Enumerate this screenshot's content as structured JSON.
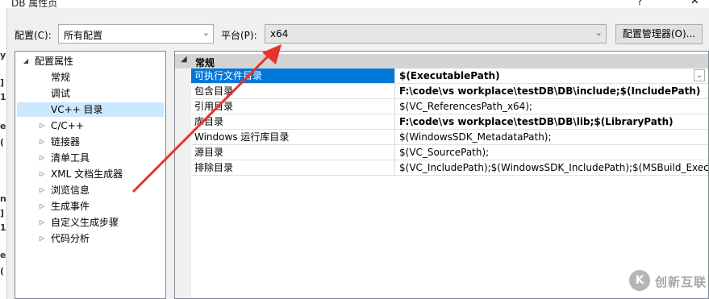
{
  "window": {
    "title": "DB 属性页",
    "help_label": "?",
    "close_label": "✕"
  },
  "left_strip_chars": [
    "y",
    "]",
    "1",
    "e",
    "(",
    "n",
    "]",
    "1",
    "e",
    "("
  ],
  "config": {
    "label": "配置(C):",
    "value": "所有配置"
  },
  "platform": {
    "label": "平台(P):",
    "value": "x64"
  },
  "config_manager_button": "配置管理器(O)...",
  "tree": {
    "root": "配置属性",
    "items": [
      {
        "label": "常规",
        "expandable": false,
        "selected": false
      },
      {
        "label": "调试",
        "expandable": false,
        "selected": false
      },
      {
        "label": "VC++ 目录",
        "expandable": false,
        "selected": true
      },
      {
        "label": "C/C++",
        "expandable": true,
        "selected": false
      },
      {
        "label": "链接器",
        "expandable": true,
        "selected": false
      },
      {
        "label": "清单工具",
        "expandable": true,
        "selected": false
      },
      {
        "label": "XML 文档生成器",
        "expandable": true,
        "selected": false
      },
      {
        "label": "浏览信息",
        "expandable": true,
        "selected": false
      },
      {
        "label": "生成事件",
        "expandable": true,
        "selected": false
      },
      {
        "label": "自定义生成步骤",
        "expandable": true,
        "selected": false
      },
      {
        "label": "代码分析",
        "expandable": true,
        "selected": false
      }
    ]
  },
  "grid": {
    "category": "常规",
    "rows": [
      {
        "name": "可执行文件目录",
        "value": "$(ExecutablePath)",
        "bold": true,
        "selected": true
      },
      {
        "name": "包含目录",
        "value": "F:\\code\\vs workplace\\testDB\\DB\\include;$(IncludePath)",
        "bold": true,
        "selected": false
      },
      {
        "name": "引用目录",
        "value": "$(VC_ReferencesPath_x64);",
        "bold": false,
        "selected": false
      },
      {
        "name": "库目录",
        "value": "F:\\code\\vs workplace\\testDB\\DB\\lib;$(LibraryPath)",
        "bold": true,
        "selected": false
      },
      {
        "name": "Windows 运行库目录",
        "value": "$(WindowsSDK_MetadataPath);",
        "bold": false,
        "selected": false
      },
      {
        "name": "源目录",
        "value": "$(VC_SourcePath);",
        "bold": false,
        "selected": false
      },
      {
        "name": "排除目录",
        "value": "$(VC_IncludePath);$(WindowsSDK_IncludePath);$(MSBuild_ExecutablePath)",
        "bold": false,
        "selected": false
      }
    ]
  },
  "watermark": {
    "logo": "K",
    "text": "创新互联"
  },
  "annotation": {
    "arrow_color": "#e8322c"
  }
}
